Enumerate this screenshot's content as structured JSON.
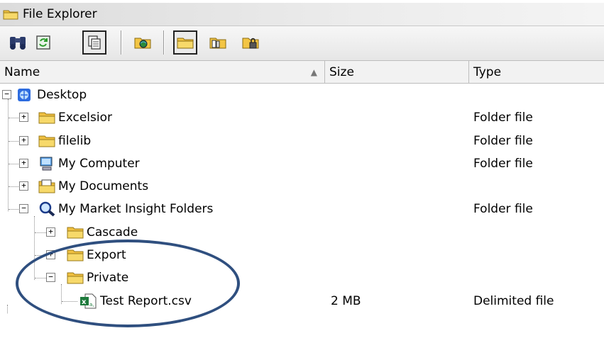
{
  "window": {
    "title": "File Explorer"
  },
  "toolbar": {
    "buttons": [
      {
        "icon": "binoculars-icon",
        "pressed": false
      },
      {
        "icon": "refresh-icon",
        "pressed": false
      },
      {
        "icon": "copy-pages-icon",
        "pressed": true
      },
      {
        "icon": "folder-globe-icon",
        "pressed": false
      },
      {
        "icon": "folder-icon",
        "pressed": true
      },
      {
        "icon": "folder-tabs-icon",
        "pressed": false
      },
      {
        "icon": "folder-lock-icon",
        "pressed": false
      }
    ]
  },
  "columns": {
    "name": "Name",
    "size": "Size",
    "type": "Type"
  },
  "tree": [
    {
      "name": "Desktop",
      "level": 0,
      "expander": "-",
      "icon": "desktop-icon",
      "size": "",
      "type": ""
    },
    {
      "name": "Excelsior",
      "level": 1,
      "expander": "+",
      "icon": "folder-icon",
      "size": "",
      "type": "Folder file"
    },
    {
      "name": "filelib",
      "level": 1,
      "expander": "+",
      "icon": "folder-icon",
      "size": "",
      "type": "Folder file"
    },
    {
      "name": "My Computer",
      "level": 1,
      "expander": "+",
      "icon": "computer-icon",
      "size": "",
      "type": "Folder file"
    },
    {
      "name": "My Documents",
      "level": 1,
      "expander": "+",
      "icon": "documents-icon",
      "size": "",
      "type": ""
    },
    {
      "name": "My Market Insight Folders",
      "level": 1,
      "expander": "-",
      "icon": "magnifier-icon",
      "size": "",
      "type": "Folder file"
    },
    {
      "name": "Cascade",
      "level": 2,
      "expander": "+",
      "icon": "folder-icon",
      "size": "",
      "type": ""
    },
    {
      "name": "Export",
      "level": 2,
      "expander": "+",
      "icon": "folder-icon",
      "size": "",
      "type": ""
    },
    {
      "name": "Private",
      "level": 2,
      "expander": "-",
      "icon": "folder-icon",
      "size": "",
      "type": ""
    },
    {
      "name": "Test Report.csv",
      "level": 3,
      "expander": "",
      "icon": "excel-csv-icon",
      "size": "2 MB",
      "type": "Delimited file"
    }
  ],
  "colors": {
    "highlight_oval": "#2f4f7f",
    "folder": "#f0c040"
  }
}
